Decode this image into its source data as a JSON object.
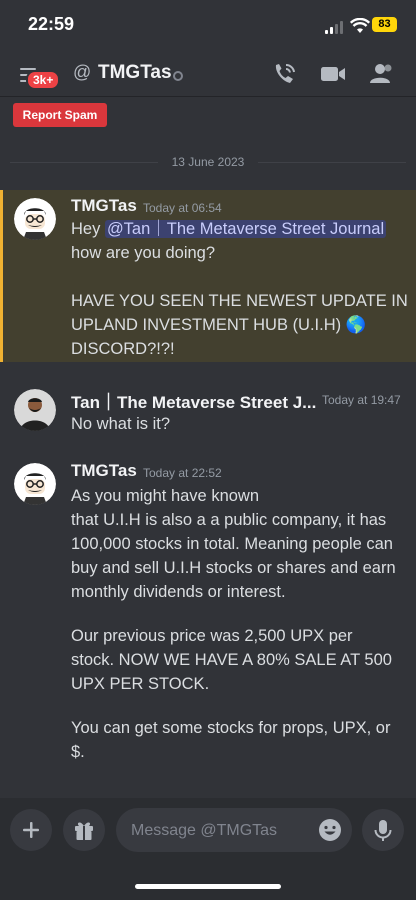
{
  "status_bar": {
    "time": "22:59",
    "battery": "83"
  },
  "header": {
    "notification_badge": "3k+",
    "at_symbol": "@",
    "channel_name": "TMGTas",
    "icons": [
      "call-icon",
      "video-icon",
      "members-icon"
    ]
  },
  "report_spam": "Report Spam",
  "date_divider": "13 June 2023",
  "messages": [
    {
      "author": "TMGTas",
      "timestamp": "Today at 06:54",
      "greeting": "Hey",
      "mention": "@Tan｜The Metaverse Street Journal",
      "lines": [
        "how are you doing?",
        "",
        "HAVE YOU SEEN THE NEWEST UPDATE IN",
        "UPLAND INVESTMENT HUB (U.I.H) 🌎",
        "DISCORD?!?!"
      ]
    },
    {
      "author": "Tan｜The Metaverse Street J...",
      "timestamp": "Today at 19:47",
      "lines": [
        "No what is it?"
      ]
    },
    {
      "author": "TMGTas",
      "timestamp": "Today at 22:52",
      "lines": [
        "As you might have known",
        "that U.I.H is also a a public company, it has",
        "100,000 stocks in total. Meaning people can",
        "buy and sell U.I.H stocks or shares and earn",
        "monthly dividends or interest.",
        "",
        "Our previous price was 2,500 UPX per",
        "stock. NOW WE HAVE A 80% SALE AT 500",
        "UPX PER STOCK.",
        "",
        "You can get some stocks for props, UPX, or",
        "$."
      ]
    }
  ],
  "composer": {
    "placeholder": "Message @TMGTas"
  },
  "colors": {
    "background": "#313338",
    "mention_highlight": "#43402f",
    "mention_bar": "#f0b232",
    "report_spam": "#da373c"
  }
}
